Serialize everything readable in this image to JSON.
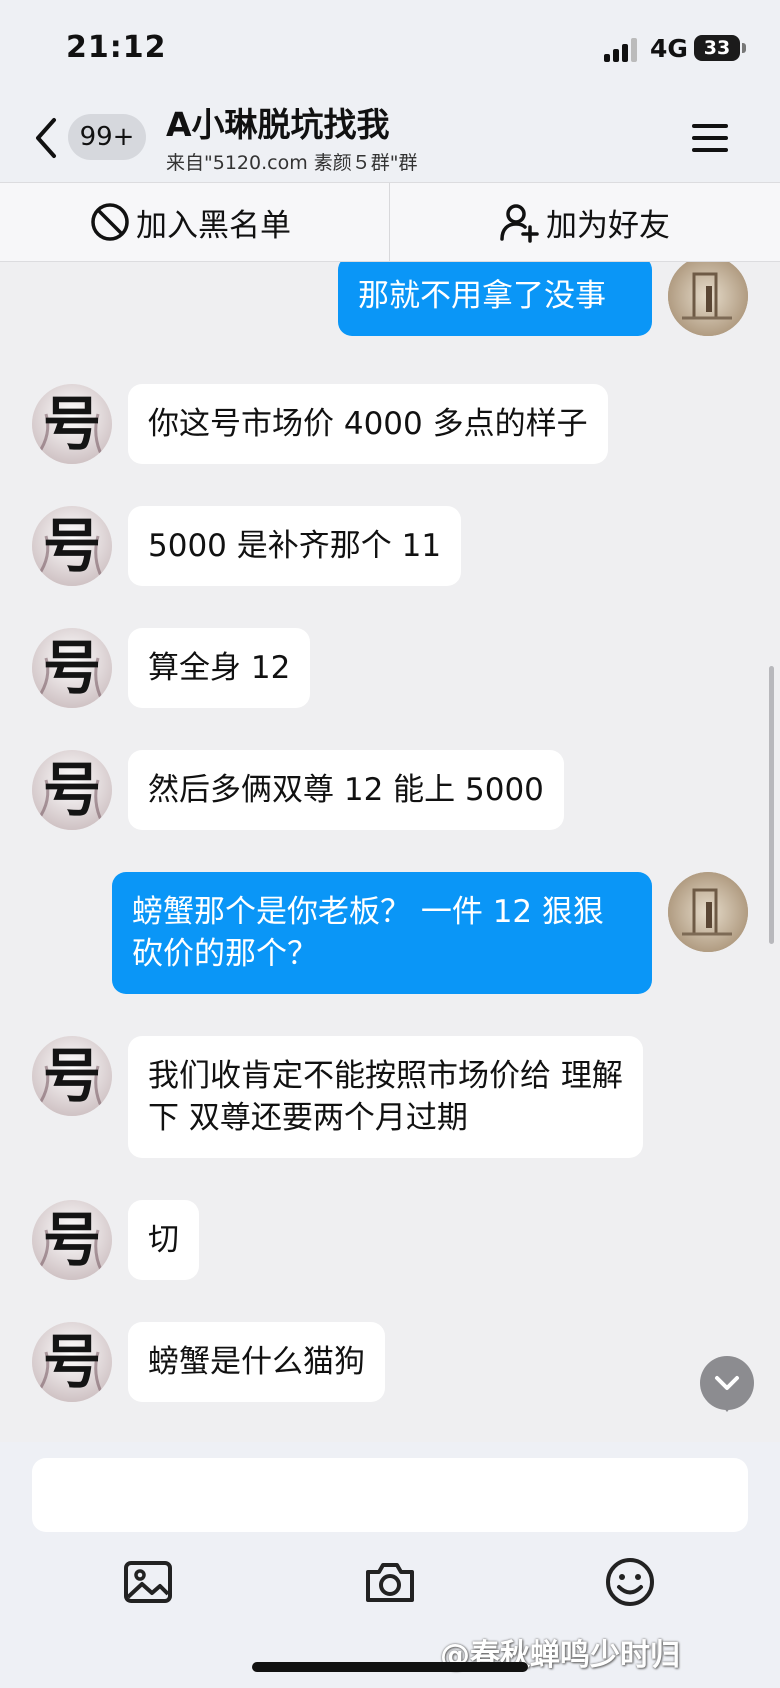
{
  "status_bar": {
    "time": "21:12",
    "network": "4G",
    "battery": "33"
  },
  "header": {
    "unread_badge": "99+",
    "title": "A小琳脱坑找我",
    "subtitle": "来自\"5120.com 素颜５群\"群"
  },
  "actions": {
    "blacklist_label": "加入黑名单",
    "add_friend_label": "加为好友"
  },
  "messages": [
    {
      "side": "out",
      "text": "那就不用拿了没事"
    },
    {
      "side": "in",
      "text": "你这号市场价 4000 多点的样子"
    },
    {
      "side": "in",
      "text": "5000 是补齐那个 11"
    },
    {
      "side": "in",
      "text": "算全身 12"
    },
    {
      "side": "in",
      "text": "然后多俩双尊 12 能上 5000"
    },
    {
      "side": "out",
      "lines": [
        "螃蟹那个是你老板？ 一件 12 狠狠",
        "砍价的那个？"
      ]
    },
    {
      "side": "in",
      "lines": [
        "我们收肯定不能按照市场价给 理解",
        "下 双尊还要两个月过期"
      ]
    },
    {
      "side": "in",
      "text": "切"
    },
    {
      "side": "in",
      "text": "螃蟹是什么猫狗"
    }
  ],
  "avatar_glyph": "号",
  "composer": {
    "input_value": ""
  },
  "watermark": "@春秋蝉鸣少时归",
  "colors": {
    "outgoing_bubble": "#0a96f7",
    "incoming_bubble": "#ffffff",
    "background": "#efeff1"
  },
  "icons": {
    "back": "chevron-left-icon",
    "menu": "hamburger-menu-icon",
    "blacklist": "ban-icon",
    "add_friend": "user-plus-icon",
    "image": "image-icon",
    "camera": "camera-icon",
    "emoji": "smile-icon",
    "scroll_down": "chevron-down-icon"
  }
}
